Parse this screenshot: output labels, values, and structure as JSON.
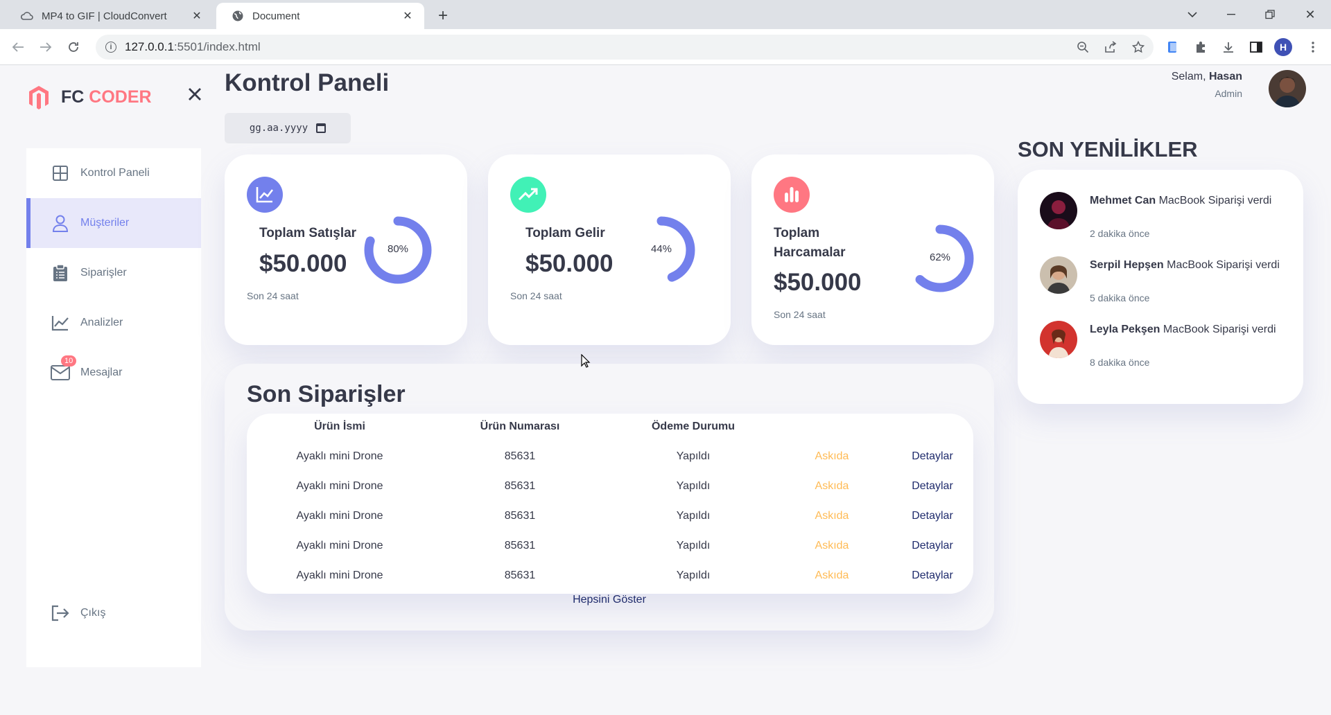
{
  "browser": {
    "tabs": [
      {
        "title": "MP4 to GIF | CloudConvert",
        "active": false
      },
      {
        "title": "Document",
        "active": true
      }
    ],
    "url_host": "127.0.0.1",
    "url_path": ":5501/index.html",
    "profile_initial": "H"
  },
  "brand": {
    "name": "FC",
    "accent": "CODER",
    "accent_color": "#ff7782"
  },
  "sidebar": {
    "items": [
      {
        "label": "Kontrol Paneli",
        "icon": "grid-icon",
        "active": false
      },
      {
        "label": "Müşteriler",
        "icon": "user-icon",
        "active": true
      },
      {
        "label": "Siparişler",
        "icon": "clipboard-icon",
        "active": false
      },
      {
        "label": "Analizler",
        "icon": "chart-icon",
        "active": false
      },
      {
        "label": "Mesajlar",
        "icon": "mail-icon",
        "active": false,
        "badge": "10"
      }
    ],
    "logout": "Çıkış"
  },
  "header": {
    "title": "Kontrol Paneli",
    "date_placeholder": "gg.aa.yyyy",
    "greeting_prefix": "Selam, ",
    "user_name": "Hasan",
    "role": "Admin"
  },
  "cards": [
    {
      "label": "Toplam Satışlar",
      "value": "$50.000",
      "note": "Son 24 saat",
      "percent": 80,
      "percent_label": "80%",
      "icon": "line-chart-icon",
      "color": "#7380ec"
    },
    {
      "label": "Toplam Gelir",
      "value": "$50.000",
      "note": "Son 24 saat",
      "percent": 44,
      "percent_label": "44%",
      "icon": "trending-up-icon",
      "color": "#41f1b6"
    },
    {
      "label_line1": "Toplam",
      "label_line2": "Harcamalar",
      "value": "$50.000",
      "note": "Son 24 saat",
      "percent": 62,
      "percent_label": "62%",
      "icon": "bar-chart-icon",
      "color": "#ff7782"
    }
  ],
  "orders": {
    "title": "Son Siparişler",
    "headers": [
      "Ürün İsmi",
      "Ürün Numarası",
      "Ödeme Durumu"
    ],
    "rows": [
      {
        "name": "Ayaklı mini Drone",
        "number": "85631",
        "payment": "Yapıldı",
        "status": "Askıda",
        "action": "Detaylar"
      },
      {
        "name": "Ayaklı mini Drone",
        "number": "85631",
        "payment": "Yapıldı",
        "status": "Askıda",
        "action": "Detaylar"
      },
      {
        "name": "Ayaklı mini Drone",
        "number": "85631",
        "payment": "Yapıldı",
        "status": "Askıda",
        "action": "Detaylar"
      },
      {
        "name": "Ayaklı mini Drone",
        "number": "85631",
        "payment": "Yapıldı",
        "status": "Askıda",
        "action": "Detaylar"
      },
      {
        "name": "Ayaklı mini Drone",
        "number": "85631",
        "payment": "Yapıldı",
        "status": "Askıda",
        "action": "Detaylar"
      }
    ],
    "show_all": "Hepsini Göster"
  },
  "updates": {
    "title": "SON YENİLİKLER",
    "items": [
      {
        "name": "Mehmet Can",
        "msg": " MacBook Siparişi verdi",
        "time": "2 dakika önce"
      },
      {
        "name": "Serpil Hepşen",
        "msg": " MacBook Siparişi verdi",
        "time": "5 dakika önce"
      },
      {
        "name": "Leyla Pekşen",
        "msg": " MacBook Siparişi verdi",
        "time": "8 dakika önce"
      }
    ]
  }
}
